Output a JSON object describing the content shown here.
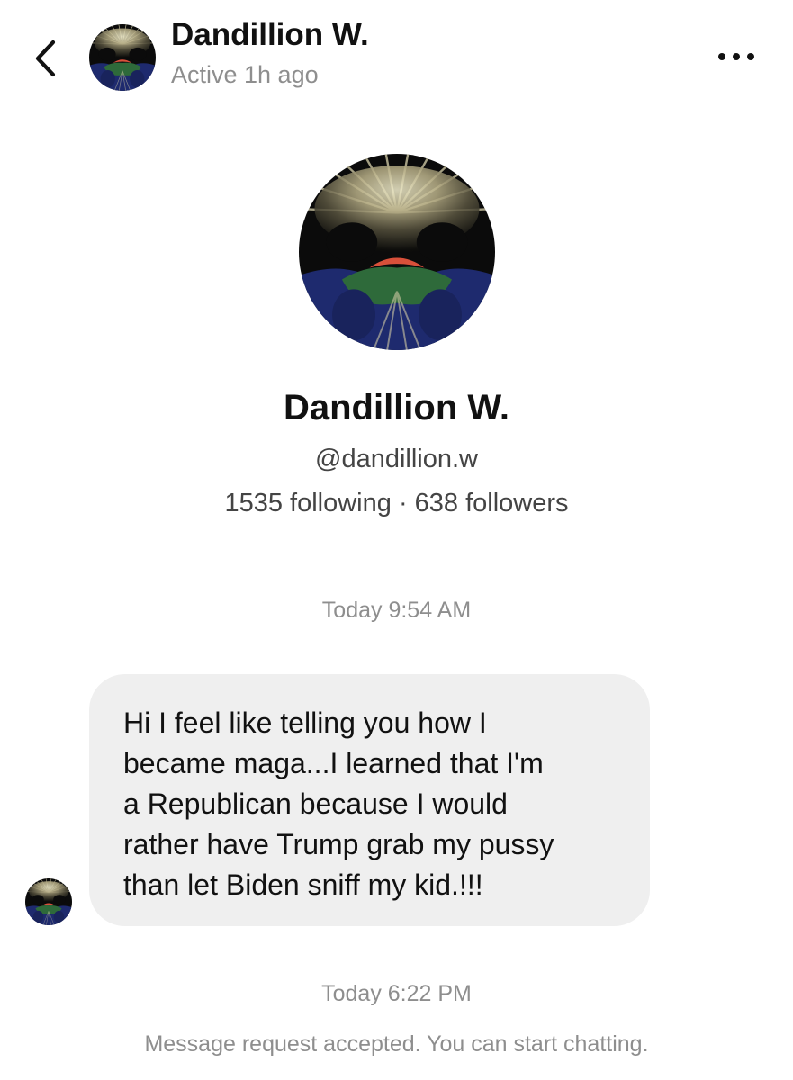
{
  "header": {
    "back_icon": "chevron-left-icon",
    "name": "Dandillion W.",
    "status": "Active 1h ago",
    "more_icon": "more-horizontal-icon"
  },
  "profile": {
    "name": "Dandillion W.",
    "handle": "@dandillion.w",
    "stats": "1535 following · 638 followers"
  },
  "conversation": {
    "timestamp_1": "Today 9:54 AM",
    "message": {
      "sender": "Dandillion W.",
      "lines": [
        "Hi I feel like telling you how I",
        "became maga...I learned that I'm",
        "a Republican because I would",
        "rather have Trump grab my pussy",
        "than let Biden sniff my kid.!!!"
      ]
    },
    "timestamp_2": "Today 6:22 PM",
    "system_notice": "Message request accepted. You can start chatting."
  },
  "colors": {
    "bubble_background": "#efefef",
    "secondary_text": "#8e8e8e"
  }
}
